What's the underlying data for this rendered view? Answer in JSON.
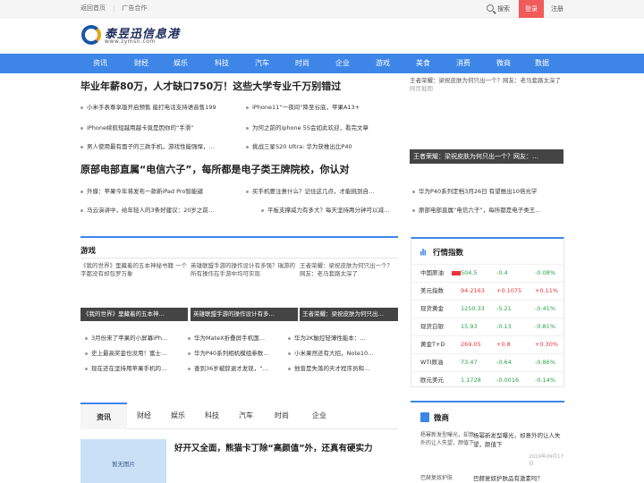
{
  "topbar": {
    "home": "返回首页",
    "ad": "广告合作",
    "search": "搜索",
    "login": "登录",
    "register": "注册"
  },
  "logo": {
    "text": "泰昱迅信息港",
    "url": "www.zymsn.com"
  },
  "nav": [
    "资讯",
    "财经",
    "娱乐",
    "科技",
    "汽车",
    "时尚",
    "企业",
    "游戏",
    "美食",
    "消费",
    "微商",
    "数据"
  ],
  "headline1": {
    "title": "毕业年薪80万，人才缺口750万！这些大学专业千万别错过",
    "items": [
      "小米手表尊享版开启预售 能打电话支持语音售199",
      "iPhone11“一夜间”降至谷底，苹果A13+",
      "iPhone续航短越用越卡竟是因你的“手滑”",
      "为何之前的iphone 5S会如此欢迎，看完文章",
      "男人使用最有面子的三款手机，游戏性能强悍，…",
      "挑战三星S20 Ultra: 华为获推出比P40"
    ]
  },
  "right_feature": {
    "alt": "王者荣耀：梁祝皮肤为何只出一个？网友：老马套路太深了",
    "alt_suffix": "网页截图",
    "caption": "王者荣耀：梁祝皮肤为何只出一个？网友：…"
  },
  "headline2": {
    "title": "原部电部直属“电信六子”，每所都是电子类王牌院校，你认对",
    "items": [
      "外媒：苹果今年将发布一款新iPad Pro智能键",
      "买手机要注意什么？记住这几点，才能挑到自…",
      "华为P40系列定档3月26日 有望推出10倍光学",
      "马云演讲中，给年轻人的3条好建议：20岁之前…",
      "平板支撑威力有多大？每天坚持两分钟可以减…",
      "原部电部直属“电信六子”，每所都是电子类王…"
    ]
  },
  "games": {
    "title": "游戏",
    "cards": [
      {
        "alt": "《我的世界》里藏着的五本神秘书籍 一个字都没有却包罗万象",
        "caption": "《我的世界》里藏着的五本神…"
      },
      {
        "alt": "英雄联盟手游的操作设计有多强？瑞游的所有操作在手游中均可实现",
        "caption": "英雄联盟手游的操作设计有多…"
      },
      {
        "alt": "王者荣耀：梁祝皮肤为何只出一个？网友：老马套路太深了",
        "caption": "王者荣耀：梁祝皮肤为何只出…"
      }
    ],
    "items": [
      "3月份来了苹果的小屏幕iPh…",
      "华为MateX折叠屏手机国…",
      "华为2K触控轻薄性能本：…",
      "史上最高奖金也没用！富士…",
      "华为P40系列相机模组参数…",
      "小米果然还有大招，Note10…",
      "现在还在坚持用苹果手机的…",
      "查到36岁被辞退才发现，“…",
      "他曾是失落的天才程序员和…"
    ]
  },
  "market": {
    "title": "行情指数",
    "rows": [
      {
        "name": "中国原油",
        "price": "504.5",
        "change": "-0.4",
        "pct": "-0.08%",
        "dir": "down"
      },
      {
        "name": "美元指数",
        "price": "94.2163",
        "change": "+0.1075",
        "pct": "+0.11%",
        "dir": "up"
      },
      {
        "name": "现货黄金",
        "price": "1250.33",
        "change": "-5.21",
        "pct": "-0.41%",
        "dir": "down"
      },
      {
        "name": "现货白银",
        "price": "15.93",
        "change": "-0.13",
        "pct": "-0.81%",
        "dir": "down"
      },
      {
        "name": "黄金T+D",
        "price": "269.05",
        "change": "+0.8",
        "pct": "+0.30%",
        "dir": "up"
      },
      {
        "name": "WTI原油",
        "price": "73.47",
        "change": "-0.64",
        "pct": "-0.86%",
        "dir": "down"
      },
      {
        "name": "欧元美元",
        "price": "1.1728",
        "change": "-0.0016",
        "pct": "-0.14%",
        "dir": "down"
      }
    ]
  },
  "tabs": [
    "资讯",
    "财经",
    "娱乐",
    "科技",
    "汽车",
    "时尚",
    "企业"
  ],
  "article": {
    "noimg": "暂无图片",
    "title": "好开又全面，熊猫卡丁除“高颜值”外，还真有硬实力"
  },
  "weibo": {
    "title": "微商",
    "items": [
      {
        "alt": "杨幂新发型曝光，却意外的让人失望，颜值下",
        "text": "杨幂新发型曝光，却意外的让人失望，颜值下",
        "date": "2019年09月17日"
      },
      {
        "alt": "巴赫复奴护肤",
        "text": "巴赫复奴护肤品有激素吗？"
      }
    ]
  },
  "colors": {
    "accent": "#3d86e8",
    "login": "#f05a5a",
    "up": "#e8353b",
    "down": "#2aa34a"
  }
}
